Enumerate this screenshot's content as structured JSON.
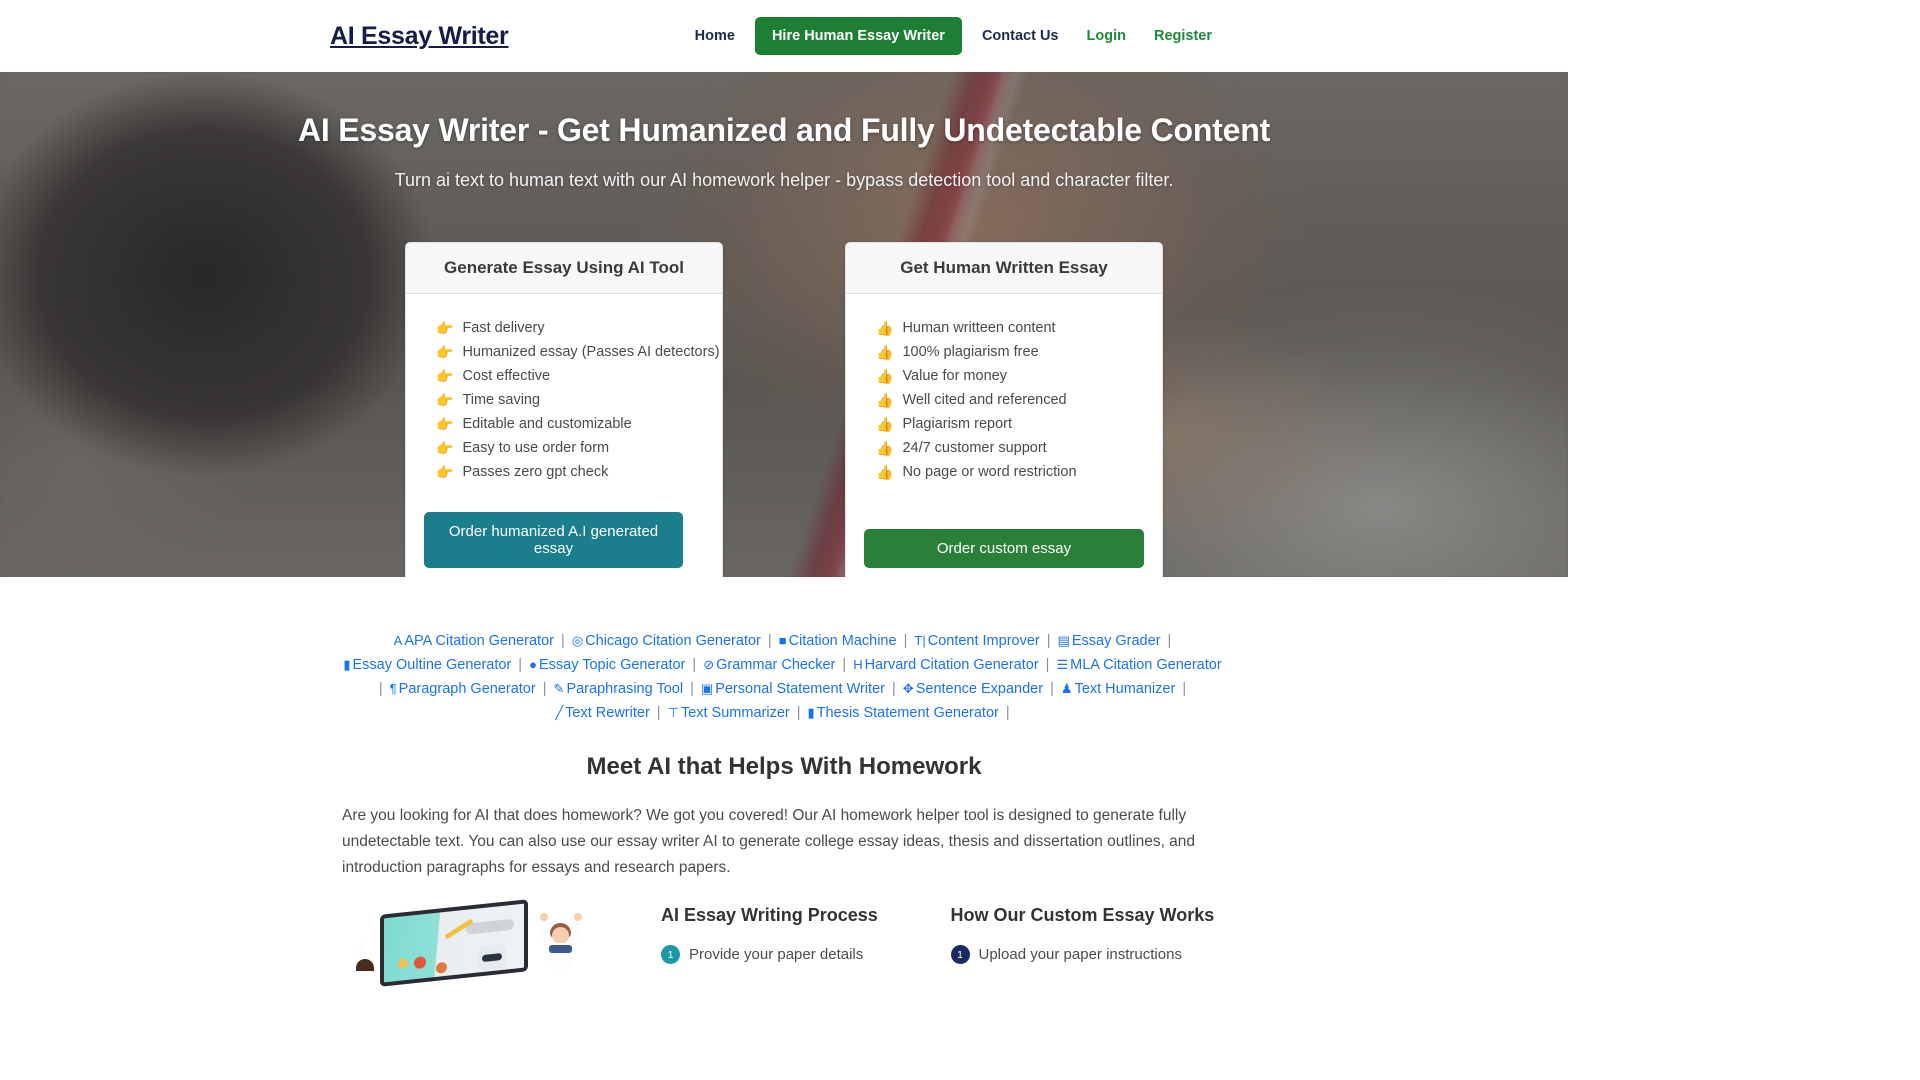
{
  "navbar": {
    "brand": "AI Essay Writer",
    "links": [
      {
        "label": "Home",
        "style": "dark"
      },
      {
        "label": "Contact Us",
        "style": "dark"
      },
      {
        "label": "Login",
        "style": "green"
      },
      {
        "label": "Register",
        "style": "green"
      }
    ],
    "cta_button": "Hire Human Essay Writer",
    "accent_green": "#1e7e34",
    "brand_color": "#151c48"
  },
  "hero": {
    "title": "AI Essay Writer - Get Humanized and Fully Undetectable Content",
    "subtitle": "Turn ai text to human text with our AI homework helper - bypass detection tool and character filter."
  },
  "cards": [
    {
      "header": "Generate Essay Using AI Tool",
      "bullet_icon": "pointing-right-hand",
      "items": [
        "Fast delivery",
        "Humanized essay (Passes AI detectors)",
        "Cost effective",
        "Time saving",
        "Editable and customizable",
        "Easy to use order form",
        "Passes zero gpt check"
      ],
      "cta": "Order humanized A.I generated essay",
      "cta_color": "#1a7e8c"
    },
    {
      "header": "Get Human Written Essay",
      "bullet_icon": "thumbs-up",
      "items": [
        "Human writteen content",
        "100% plagiarism free",
        "Value for money",
        "Well cited and referenced",
        "Plagiarism report",
        "24/7 customer support",
        "No page or word restriction"
      ],
      "cta": "Order custom essay",
      "cta_color": "#2a8039"
    }
  ],
  "tools": {
    "link_color": "#1a73e8",
    "items": [
      {
        "icon": "letter-a-icon",
        "glyph": "A",
        "label": "APA Citation Generator"
      },
      {
        "icon": "target-icon",
        "glyph": "◎",
        "label": "Chicago Citation Generator"
      },
      {
        "icon": "card-icon",
        "glyph": "■",
        "label": "Citation Machine"
      },
      {
        "icon": "text-height-icon",
        "glyph": "T|",
        "label": "Content Improver"
      },
      {
        "icon": "book-icon",
        "glyph": "▤",
        "label": "Essay Grader"
      },
      {
        "icon": "file-icon",
        "glyph": "▮",
        "label": "Essay Oultine Generator"
      },
      {
        "icon": "comment-icon",
        "glyph": "●",
        "label": "Essay Topic Generator"
      },
      {
        "icon": "check-circle-icon",
        "glyph": "⊘",
        "label": "Grammar Checker"
      },
      {
        "icon": "letter-h-icon",
        "glyph": "H",
        "label": "Harvard Citation Generator"
      },
      {
        "icon": "list-icon",
        "glyph": "☰",
        "label": "MLA Citation Generator"
      },
      {
        "icon": "paragraph-icon",
        "glyph": "¶",
        "label": "Paragraph Generator"
      },
      {
        "icon": "pen-square-icon",
        "glyph": "✎",
        "label": "Paraphrasing Tool"
      },
      {
        "icon": "id-card-icon",
        "glyph": "▣",
        "label": "Personal Statement Writer"
      },
      {
        "icon": "arrows-icon",
        "glyph": "✥",
        "label": "Sentence Expander"
      },
      {
        "icon": "user-icon",
        "glyph": "♟",
        "label": "Text Humanizer"
      },
      {
        "icon": "pencil-icon",
        "glyph": "╱",
        "label": "Text Rewriter"
      },
      {
        "icon": "text-width-icon",
        "glyph": "⊤",
        "label": "Text Summarizer"
      },
      {
        "icon": "file-alt-icon",
        "glyph": "▮",
        "label": "Thesis Statement Generator"
      }
    ]
  },
  "meet_section": {
    "title": "Meet AI that Helps With Homework",
    "paragraph": "Are you looking for AI that does homework? We got you covered! Our AI homework helper tool is designed to generate fully undetectable text. You can also use our essay writer AI to generate college essay ideas, thesis and dissertation outlines, and introduction paragraphs for essays and research papers."
  },
  "process_columns": [
    {
      "title": "AI Essay Writing Process",
      "badge_color": "#1a9aa8",
      "steps": [
        {
          "number": "1",
          "label": "Provide your paper details"
        }
      ]
    },
    {
      "title": "How Our Custom Essay Works",
      "badge_color": "#1b2a63",
      "steps": [
        {
          "number": "1",
          "label": "Upload your paper instructions"
        }
      ]
    }
  ]
}
